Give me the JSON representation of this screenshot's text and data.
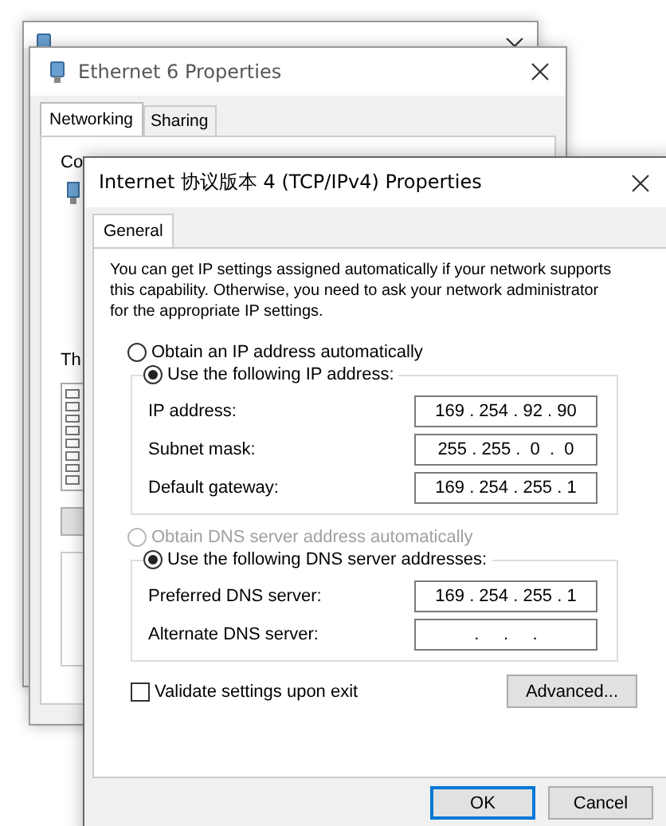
{
  "properties_window": {
    "title": "Ethernet 6 Properties",
    "tabs": [
      {
        "label": "Networking",
        "selected": true
      },
      {
        "label": "Sharing",
        "selected": false
      }
    ],
    "fragments": [
      "Co",
      "Th"
    ]
  },
  "ipv4_window": {
    "title": "Internet 协议版本 4 (TCP/IPv4) Properties",
    "tabs": [
      {
        "label": "General",
        "selected": true
      }
    ],
    "description": "You can get IP settings assigned automatically if your network supports this capability. Otherwise, you need to ask your network administrator for the appropriate IP settings.",
    "ip_options": [
      {
        "label": "Obtain an IP address automatically",
        "selected": false,
        "disabled": false
      },
      {
        "label": "Use the following IP address:",
        "selected": true,
        "disabled": false
      }
    ],
    "ip_fields": [
      {
        "label": "IP address:",
        "value": "169 . 254 . 92 . 90"
      },
      {
        "label": "Subnet mask:",
        "value": "255 . 255 .  0  .  0"
      },
      {
        "label": "Default gateway:",
        "value": "169 . 254 . 255 . 1"
      }
    ],
    "dns_options": [
      {
        "label": "Obtain DNS server address automatically",
        "selected": false,
        "disabled": true
      },
      {
        "label": "Use the following DNS server addresses:",
        "selected": true,
        "disabled": false
      }
    ],
    "dns_fields": [
      {
        "label": "Preferred DNS server:",
        "value": "169 . 254 . 255 . 1"
      },
      {
        "label": "Alternate DNS server:",
        "value": ".     .     ."
      }
    ],
    "validate": {
      "label": "Validate settings upon exit",
      "checked": false
    },
    "advanced_button": "Advanced...",
    "buttons": [
      {
        "label": "OK",
        "default": true
      },
      {
        "label": "Cancel",
        "default": false
      }
    ]
  }
}
